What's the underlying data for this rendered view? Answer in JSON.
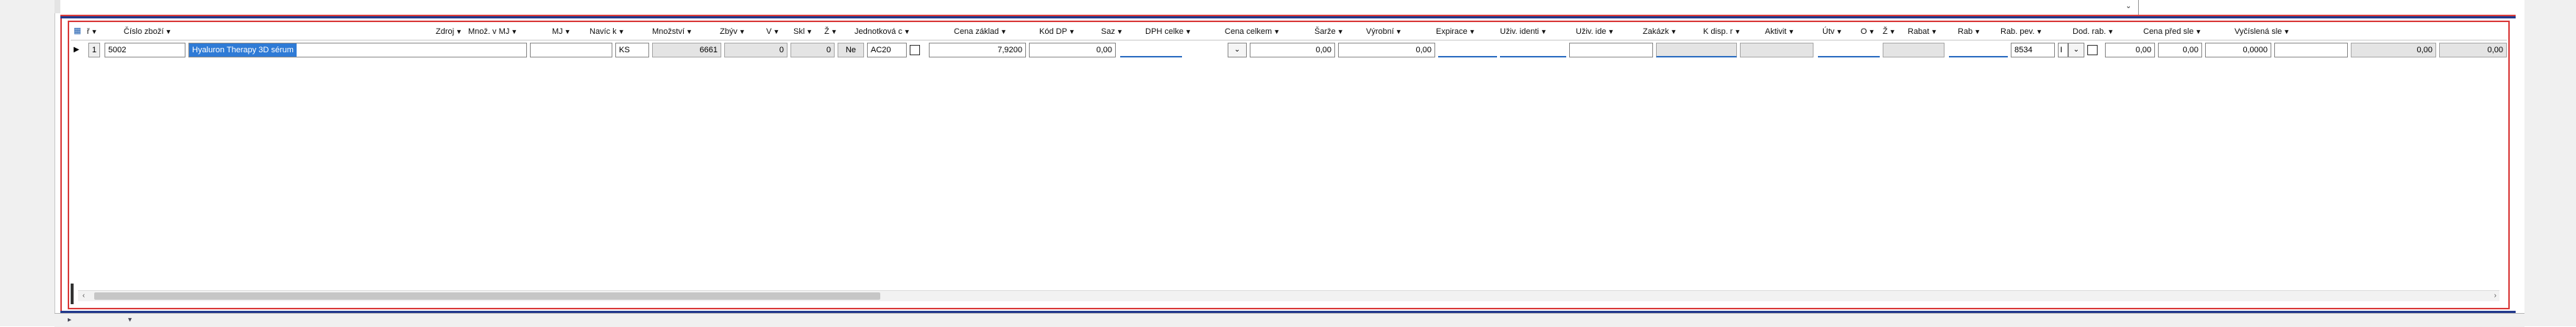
{
  "columns": [
    {
      "label": "ř"
    },
    {
      "label": "Číslo zboží"
    },
    {
      "label": "Zdroj"
    },
    {
      "label": "Množ. v MJ"
    },
    {
      "label": "MJ"
    },
    {
      "label": "Navíc k"
    },
    {
      "label": "Množství"
    },
    {
      "label": "Zbýv"
    },
    {
      "label": "V"
    },
    {
      "label": "Skl"
    },
    {
      "label": "Ž"
    },
    {
      "label": "Jednotková c"
    },
    {
      "label": "Cena základ"
    },
    {
      "label": "Kód DP"
    },
    {
      "label": "Saz"
    },
    {
      "label": "DPH celke"
    },
    {
      "label": "Cena celkem"
    },
    {
      "label": "Šarže"
    },
    {
      "label": "Výrobní"
    },
    {
      "label": "Expirace"
    },
    {
      "label": "Uživ. identi"
    },
    {
      "label": "Uživ. ide"
    },
    {
      "label": "Zakázk"
    },
    {
      "label": "K disp. r"
    },
    {
      "label": "Aktivit"
    },
    {
      "label": "Útv"
    },
    {
      "label": "O"
    },
    {
      "label": "Ž"
    },
    {
      "label": "Rabat"
    },
    {
      "label": "Rab"
    },
    {
      "label": "Rab. pev."
    },
    {
      "label": "Dod. rab."
    },
    {
      "label": "Cena před sle"
    },
    {
      "label": "Vyčíslená sle"
    }
  ],
  "row": {
    "num": "1",
    "item_number": "5002",
    "item_name": "Hyaluron Therapy 3D sérum",
    "mj": "KS",
    "extra": "6661",
    "quantity": "0",
    "remaining": "0",
    "v": "Ne",
    "warehouse": "AC20",
    "unit_price": "7,9200",
    "base_price": "0,00",
    "vat_total": "0,00",
    "total_price": "0,00",
    "dept": "8534",
    "o_value": "I",
    "rabat": "0,00",
    "rab": "0,00",
    "rab_fixed": "0,0000",
    "price_before": "0,00",
    "calculated": "0,00"
  }
}
